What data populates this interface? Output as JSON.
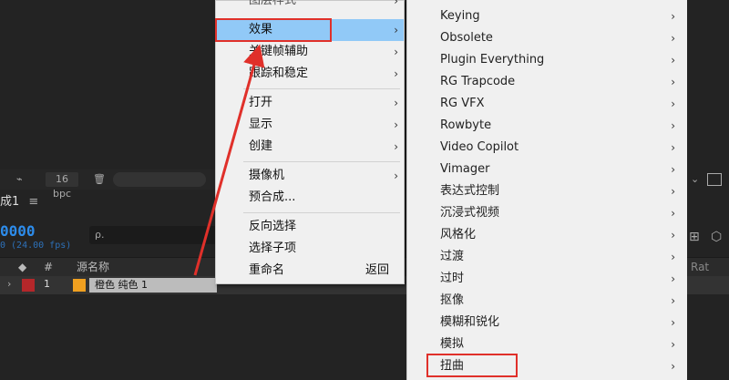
{
  "background": {
    "toolbar": {
      "bpc": "16 bpc"
    },
    "panel_tab": "成1",
    "timecode": "0000",
    "fps": "0 (24.00 fps)",
    "search_placeholder": "ρ.",
    "columns": {
      "hash": "#",
      "source_name": "源名称",
      "right_label": "Rat"
    },
    "layer": {
      "index": "1",
      "name": "橙色 纯色 1"
    }
  },
  "context_menu": {
    "top_partial": "图层样式",
    "items": [
      {
        "label": "效果",
        "submenu": true,
        "highlighted": true
      },
      {
        "label": "关键帧辅助",
        "submenu": true
      },
      {
        "label": "跟踪和稳定",
        "submenu": true
      },
      {
        "label": "打开",
        "submenu": true
      },
      {
        "label": "显示",
        "submenu": true
      },
      {
        "label": "创建",
        "submenu": true
      },
      {
        "label": "摄像机",
        "submenu": true
      },
      {
        "label": "预合成..."
      },
      {
        "label": "反向选择"
      },
      {
        "label": "选择子项"
      },
      {
        "label": "重命名",
        "shortcut": "返回"
      }
    ]
  },
  "effects_submenu": {
    "items": [
      "Keying",
      "Obsolete",
      "Plugin Everything",
      "RG Trapcode",
      "RG VFX",
      "Rowbyte",
      "Video Copilot",
      "Vimager",
      "表达式控制",
      "沉浸式视频",
      "风格化",
      "过渡",
      "过时",
      "抠像",
      "模糊和锐化",
      "模拟",
      "扭曲"
    ]
  },
  "colors": {
    "highlight": "#91c9f7",
    "annotation": "#e0302a",
    "timecode": "#2d8ceb"
  }
}
